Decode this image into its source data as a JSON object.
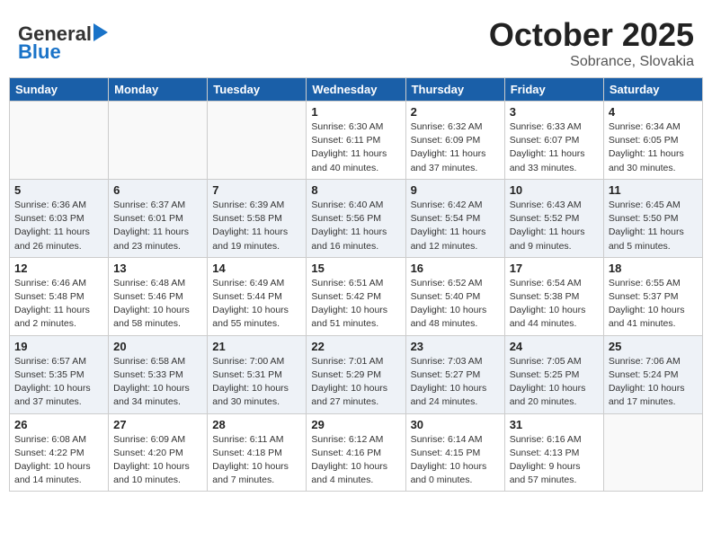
{
  "header": {
    "logo_line1": "General",
    "logo_line2": "Blue",
    "month": "October 2025",
    "location": "Sobrance, Slovakia"
  },
  "weekdays": [
    "Sunday",
    "Monday",
    "Tuesday",
    "Wednesday",
    "Thursday",
    "Friday",
    "Saturday"
  ],
  "weeks": [
    [
      {
        "day": "",
        "info": ""
      },
      {
        "day": "",
        "info": ""
      },
      {
        "day": "",
        "info": ""
      },
      {
        "day": "1",
        "info": "Sunrise: 6:30 AM\nSunset: 6:11 PM\nDaylight: 11 hours\nand 40 minutes."
      },
      {
        "day": "2",
        "info": "Sunrise: 6:32 AM\nSunset: 6:09 PM\nDaylight: 11 hours\nand 37 minutes."
      },
      {
        "day": "3",
        "info": "Sunrise: 6:33 AM\nSunset: 6:07 PM\nDaylight: 11 hours\nand 33 minutes."
      },
      {
        "day": "4",
        "info": "Sunrise: 6:34 AM\nSunset: 6:05 PM\nDaylight: 11 hours\nand 30 minutes."
      }
    ],
    [
      {
        "day": "5",
        "info": "Sunrise: 6:36 AM\nSunset: 6:03 PM\nDaylight: 11 hours\nand 26 minutes."
      },
      {
        "day": "6",
        "info": "Sunrise: 6:37 AM\nSunset: 6:01 PM\nDaylight: 11 hours\nand 23 minutes."
      },
      {
        "day": "7",
        "info": "Sunrise: 6:39 AM\nSunset: 5:58 PM\nDaylight: 11 hours\nand 19 minutes."
      },
      {
        "day": "8",
        "info": "Sunrise: 6:40 AM\nSunset: 5:56 PM\nDaylight: 11 hours\nand 16 minutes."
      },
      {
        "day": "9",
        "info": "Sunrise: 6:42 AM\nSunset: 5:54 PM\nDaylight: 11 hours\nand 12 minutes."
      },
      {
        "day": "10",
        "info": "Sunrise: 6:43 AM\nSunset: 5:52 PM\nDaylight: 11 hours\nand 9 minutes."
      },
      {
        "day": "11",
        "info": "Sunrise: 6:45 AM\nSunset: 5:50 PM\nDaylight: 11 hours\nand 5 minutes."
      }
    ],
    [
      {
        "day": "12",
        "info": "Sunrise: 6:46 AM\nSunset: 5:48 PM\nDaylight: 11 hours\nand 2 minutes."
      },
      {
        "day": "13",
        "info": "Sunrise: 6:48 AM\nSunset: 5:46 PM\nDaylight: 10 hours\nand 58 minutes."
      },
      {
        "day": "14",
        "info": "Sunrise: 6:49 AM\nSunset: 5:44 PM\nDaylight: 10 hours\nand 55 minutes."
      },
      {
        "day": "15",
        "info": "Sunrise: 6:51 AM\nSunset: 5:42 PM\nDaylight: 10 hours\nand 51 minutes."
      },
      {
        "day": "16",
        "info": "Sunrise: 6:52 AM\nSunset: 5:40 PM\nDaylight: 10 hours\nand 48 minutes."
      },
      {
        "day": "17",
        "info": "Sunrise: 6:54 AM\nSunset: 5:38 PM\nDaylight: 10 hours\nand 44 minutes."
      },
      {
        "day": "18",
        "info": "Sunrise: 6:55 AM\nSunset: 5:37 PM\nDaylight: 10 hours\nand 41 minutes."
      }
    ],
    [
      {
        "day": "19",
        "info": "Sunrise: 6:57 AM\nSunset: 5:35 PM\nDaylight: 10 hours\nand 37 minutes."
      },
      {
        "day": "20",
        "info": "Sunrise: 6:58 AM\nSunset: 5:33 PM\nDaylight: 10 hours\nand 34 minutes."
      },
      {
        "day": "21",
        "info": "Sunrise: 7:00 AM\nSunset: 5:31 PM\nDaylight: 10 hours\nand 30 minutes."
      },
      {
        "day": "22",
        "info": "Sunrise: 7:01 AM\nSunset: 5:29 PM\nDaylight: 10 hours\nand 27 minutes."
      },
      {
        "day": "23",
        "info": "Sunrise: 7:03 AM\nSunset: 5:27 PM\nDaylight: 10 hours\nand 24 minutes."
      },
      {
        "day": "24",
        "info": "Sunrise: 7:05 AM\nSunset: 5:25 PM\nDaylight: 10 hours\nand 20 minutes."
      },
      {
        "day": "25",
        "info": "Sunrise: 7:06 AM\nSunset: 5:24 PM\nDaylight: 10 hours\nand 17 minutes."
      }
    ],
    [
      {
        "day": "26",
        "info": "Sunrise: 6:08 AM\nSunset: 4:22 PM\nDaylight: 10 hours\nand 14 minutes."
      },
      {
        "day": "27",
        "info": "Sunrise: 6:09 AM\nSunset: 4:20 PM\nDaylight: 10 hours\nand 10 minutes."
      },
      {
        "day": "28",
        "info": "Sunrise: 6:11 AM\nSunset: 4:18 PM\nDaylight: 10 hours\nand 7 minutes."
      },
      {
        "day": "29",
        "info": "Sunrise: 6:12 AM\nSunset: 4:16 PM\nDaylight: 10 hours\nand 4 minutes."
      },
      {
        "day": "30",
        "info": "Sunrise: 6:14 AM\nSunset: 4:15 PM\nDaylight: 10 hours\nand 0 minutes."
      },
      {
        "day": "31",
        "info": "Sunrise: 6:16 AM\nSunset: 4:13 PM\nDaylight: 9 hours\nand 57 minutes."
      },
      {
        "day": "",
        "info": ""
      }
    ]
  ]
}
